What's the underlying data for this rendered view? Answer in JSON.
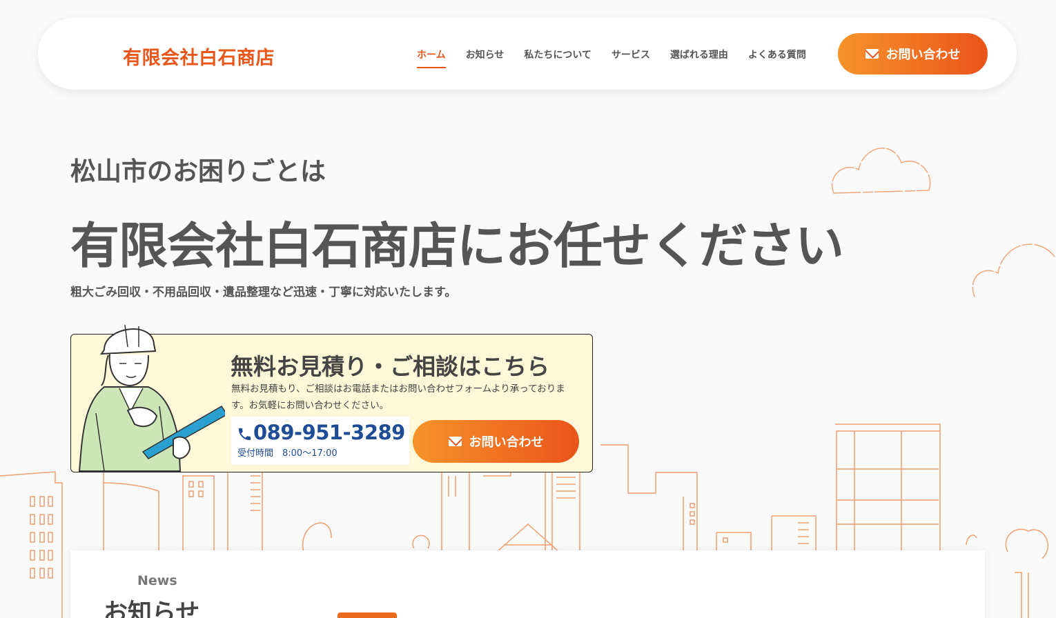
{
  "header": {
    "logo": "有限会社白石商店",
    "nav": [
      "ホーム",
      "お知らせ",
      "私たちについて",
      "サービス",
      "選ばれる理由",
      "よくある質問"
    ],
    "cta_label": "お問い合わせ"
  },
  "hero": {
    "lead": "松山市のお困りごとは",
    "title": "有限会社白石商店にお任せください",
    "subtitle": "粗大ごみ回収・不用品回収・遺品整理など迅速・丁寧に対応いたします。"
  },
  "cta": {
    "title": "無料お見積り・ご相談はこちら",
    "description": "無料お見積もり、ご相談はお電話またはお問い合わせフォームより承っております。お気軽にお問い合わせください。",
    "phone": "089-951-3289",
    "hours": "受付時間　8:00〜17:00",
    "button_label": "お問い合わせ"
  },
  "news": {
    "label_en": "News",
    "label_jp": "お知らせ"
  },
  "colors": {
    "accent": "#e8561a",
    "gradient_start": "#f7932b",
    "gradient_end": "#ea541a",
    "phone_blue": "#1e4d96",
    "cta_bg": "#fff8d8"
  }
}
